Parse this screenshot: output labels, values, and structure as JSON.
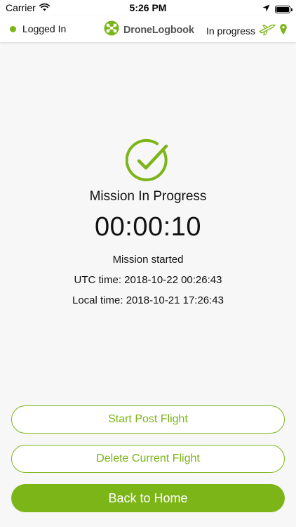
{
  "status_bar": {
    "carrier": "Carrier",
    "time": "5:26 PM"
  },
  "header": {
    "login_status": "Logged In",
    "logo_text": "DroneLogbook",
    "flight_status": "In progress"
  },
  "mission": {
    "title": "Mission In Progress",
    "timer": "00:00:10",
    "started_label": "Mission started",
    "utc_time": "UTC time: 2018-10-22 00:26:43",
    "local_time": "Local time: 2018-10-21 17:26:43"
  },
  "buttons": {
    "start_post_flight": "Start Post Flight",
    "delete_current_flight": "Delete Current Flight",
    "back_to_home": "Back to Home"
  },
  "colors": {
    "accent": "#7cb518",
    "background": "#f7f7f7",
    "header_bg": "#ffffff"
  },
  "icons": {
    "wifi": "wifi-icon",
    "location": "location-arrow-icon",
    "battery": "battery-icon",
    "logo": "dronelogbook-logo-icon",
    "drone_status": "drone-icon",
    "gps_pin": "map-pin-icon",
    "success": "checkmark-circle-icon"
  }
}
